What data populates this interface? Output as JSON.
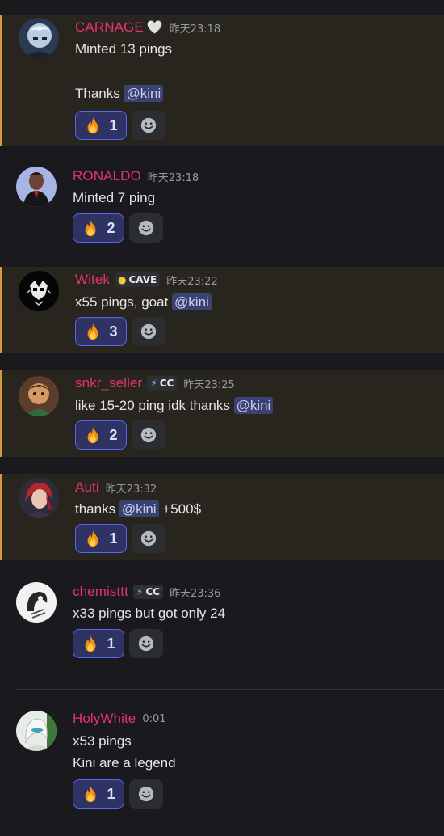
{
  "messages": [
    {
      "username": "CARNAGE",
      "badge_heart": "🤍",
      "timestamp": "昨天23:18",
      "lines": [
        "Minted 13 pings",
        "Thanks "
      ],
      "mention": "@kini",
      "reaction": {
        "emoji": "fire-emoji",
        "count": "1"
      }
    },
    {
      "username": "RONALDO",
      "timestamp": "昨天23:18",
      "lines": [
        "Minted 7 ping"
      ],
      "reaction": {
        "emoji": "fire-emoji",
        "count": "2"
      }
    },
    {
      "username": "Witek",
      "tag": {
        "icon": "skull-icon",
        "text": "CAVE"
      },
      "timestamp": "昨天23:22",
      "lines": [
        "x55 pings, goat "
      ],
      "mention": "@kini",
      "reaction": {
        "emoji": "fire-emoji",
        "count": "3"
      }
    },
    {
      "username": "snkr_seller",
      "tag": {
        "icon": "lightning-icon",
        "text": "CC"
      },
      "timestamp": "昨天23:25",
      "lines": [
        "like 15-20 ping idk thanks "
      ],
      "mention": "@kini",
      "reaction": {
        "emoji": "fire-emoji",
        "count": "2"
      }
    },
    {
      "username": "Auti",
      "timestamp": "昨天23:32",
      "lines": [
        "thanks "
      ],
      "mention": "@kini",
      "suffix": " +500$",
      "reaction": {
        "emoji": "fire-emoji",
        "count": "1"
      }
    },
    {
      "username": "chemisttt",
      "tag": {
        "icon": "lightning-icon",
        "text": "CC"
      },
      "timestamp": "昨天23:36",
      "lines": [
        "x33 pings but got only 24"
      ],
      "reaction": {
        "emoji": "fire-emoji",
        "count": "1"
      }
    },
    {
      "username": "HolyWhite",
      "timestamp": "0:01",
      "lines": [
        "x53 pings",
        "Kini are a legend"
      ],
      "reaction": {
        "emoji": "fire-emoji",
        "count": "1"
      }
    }
  ],
  "colors": {
    "background": "#1a1a1e",
    "mention_highlight_bg": "#28251f",
    "mention_bar": "#d59b3b",
    "username": "#e4336b",
    "mention_chip_bg": "#3c4270",
    "reaction_bg": "#2f3363",
    "reaction_border": "#5865f2"
  },
  "icons": {
    "add_reaction": "smiley-face-icon",
    "reaction": "fire-emoji"
  }
}
